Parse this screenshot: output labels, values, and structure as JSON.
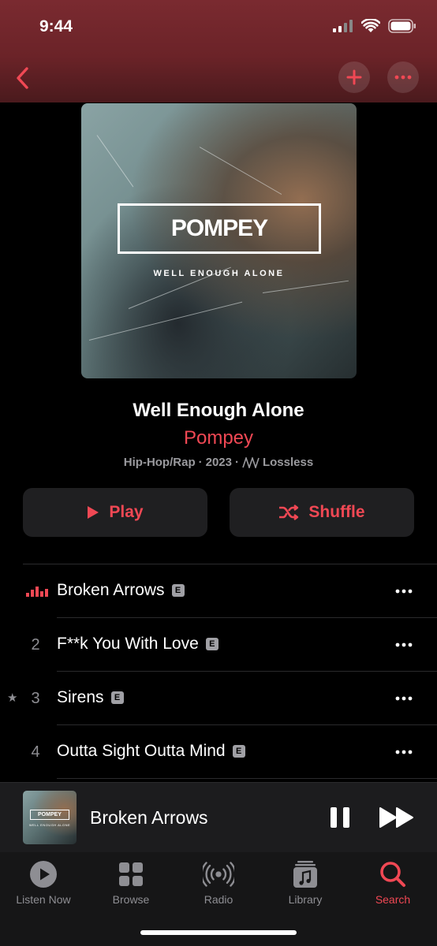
{
  "status": {
    "time": "9:44"
  },
  "album": {
    "title": "Well Enough Alone",
    "artist": "Pompey",
    "genre": "Hip-Hop/Rap",
    "year": "2023",
    "quality": "Lossless",
    "dot": "·"
  },
  "artwork": {
    "title": "POMPEY",
    "subtitle": "WELL ENOUGH ALONE"
  },
  "actions": {
    "play_label": "Play",
    "shuffle_label": "Shuffle"
  },
  "tracks": [
    {
      "number": "",
      "title": "Broken Arrows",
      "explicit": "E",
      "playing": true
    },
    {
      "number": "2",
      "title": "F**k You With Love",
      "explicit": "E"
    },
    {
      "number": "3",
      "title": "Sirens",
      "explicit": "E",
      "starred": true
    },
    {
      "number": "4",
      "title": "Outta Sight Outta Mind",
      "explicit": "E"
    }
  ],
  "now_playing": {
    "title": "Broken Arrows"
  },
  "tabs": [
    {
      "label": "Listen Now",
      "icon": "play-circle-icon"
    },
    {
      "label": "Browse",
      "icon": "grid-icon"
    },
    {
      "label": "Radio",
      "icon": "radio-waves-icon"
    },
    {
      "label": "Library",
      "icon": "library-music-icon"
    },
    {
      "label": "Search",
      "icon": "search-icon",
      "active": true
    }
  ],
  "colors": {
    "accent": "#f04854",
    "header": "#6b2328",
    "background": "#000000"
  }
}
